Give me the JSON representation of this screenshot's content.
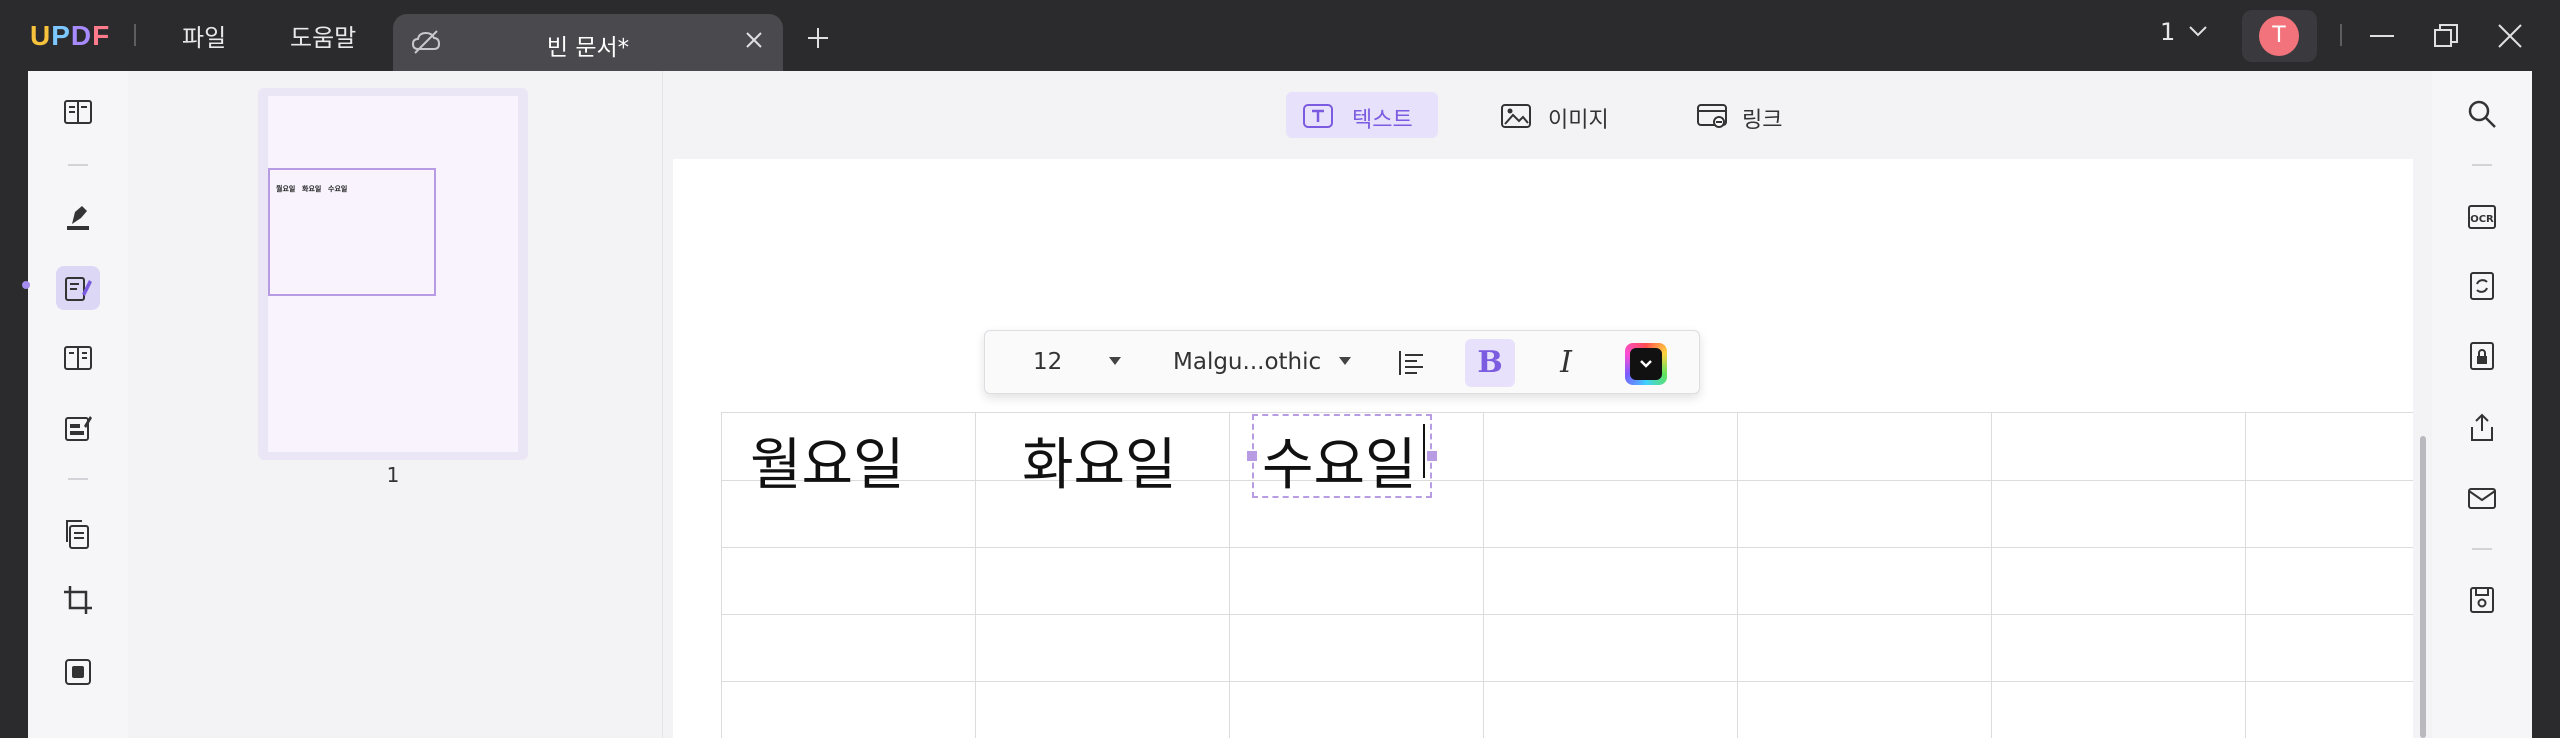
{
  "app": {
    "logo": {
      "l1": "U",
      "l2": "P",
      "l3": "D",
      "l4": "F"
    },
    "menu": {
      "file": "파일",
      "help": "도움말"
    },
    "tab": {
      "title": "빈 문서*"
    },
    "page_indicator": "1",
    "avatar_initial": "T"
  },
  "toolbar": {
    "text": "텍스트",
    "image": "이미지",
    "link": "링크"
  },
  "format_bar": {
    "font_size": "12",
    "font_name": "Malgu...othic",
    "bold": "B",
    "italic": "I",
    "color": "#000000"
  },
  "thumbnails": {
    "page_number": "1",
    "mini_labels": [
      "월요일",
      "화요일",
      "수요일"
    ]
  },
  "document": {
    "cells": [
      "월요일",
      "화요일",
      "수요일"
    ]
  },
  "colors": {
    "accent": "#7b5ce0",
    "accent_light": "#e8e1fb",
    "titlebar": "#2b2b2e",
    "avatar": "#f2737b"
  }
}
